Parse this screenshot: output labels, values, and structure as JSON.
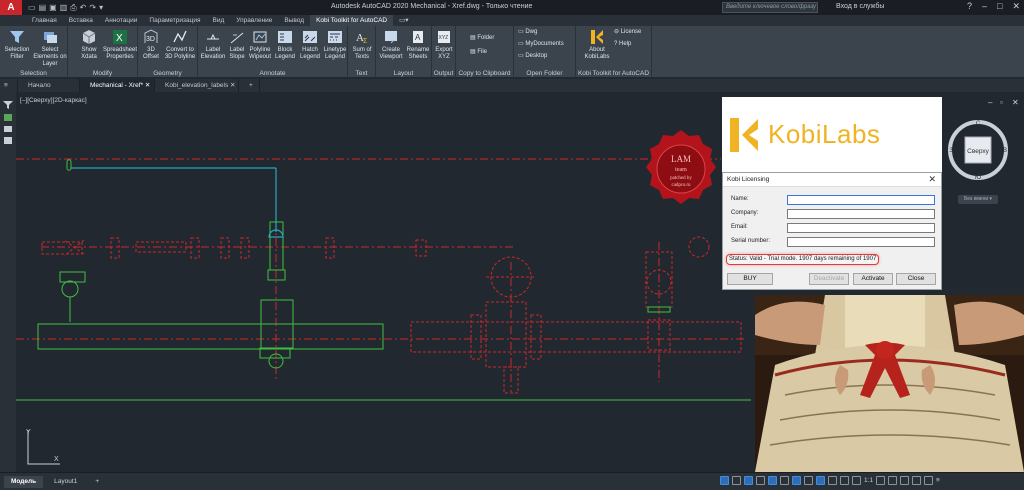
{
  "titlebar": {
    "app_logo": "A",
    "title": "Autodesk AutoCAD 2020   Mechanical - Xref.dwg - Только чтение",
    "search_placeholder": "Введите ключевое слово/фразу",
    "signin": "Вход в службы",
    "qat_icons": [
      "new-icon",
      "open-icon",
      "save-icon",
      "saveas-icon",
      "print-icon",
      "undo-icon",
      "redo-icon",
      "share-icon"
    ]
  },
  "ribbon_tabs": [
    "Главная",
    "Вставка",
    "Аннотации",
    "Параметризация",
    "Вид",
    "Управление",
    "Вывод",
    "Kobi Toolkit for AutoCAD"
  ],
  "active_ribbon_tab": "Kobi Toolkit for AutoCAD",
  "ribbon": {
    "selection": {
      "title": "Selection",
      "buttons": [
        "Selection Filter",
        "Select Elements on Layer"
      ]
    },
    "modify": {
      "title": "Modify",
      "buttons": [
        "Show Xdata",
        "Spreadsheet Properties"
      ]
    },
    "geometry": {
      "title": "Geometry",
      "buttons": [
        "3D Offset",
        "Convert to 3D Polyline"
      ]
    },
    "annotate": {
      "title": "Annotate",
      "buttons": [
        "Label Elevation",
        "Label Slope",
        "Polyline Wipeout",
        "Block Legend",
        "Hatch Legend",
        "Linetype Legend"
      ]
    },
    "text": {
      "title": "Text",
      "buttons": [
        "Sum of Texts"
      ]
    },
    "layout": {
      "title": "Layout",
      "buttons": [
        "Create Viewport",
        "Rename Sheets"
      ]
    },
    "output": {
      "title": "Output",
      "buttons": [
        "Export XYZ"
      ]
    },
    "clipboard": {
      "title": "Copy to Clipboard",
      "buttons": [
        "Folder",
        "File"
      ]
    },
    "openfolder": {
      "title": "Open Folder",
      "buttons": [
        "Dwg",
        "MyDocuments",
        "Desktop"
      ]
    },
    "kobi": {
      "title": "Kobi Toolkit for AutoCAD",
      "buttons": [
        "About KobiLabs",
        "License",
        "Help"
      ]
    }
  },
  "doc_tabs": [
    "Начало",
    "Mechanical - Xref*",
    "Kobi_elevation_labels"
  ],
  "view_label": "[–][Сверху][2D-каркас]",
  "viewcube": {
    "face": "Сверху",
    "compass": [
      "С",
      "В",
      "Ю",
      "З"
    ],
    "wcs": "Без имени"
  },
  "kobi_logo_text": "KobiLabs",
  "dialog": {
    "title": "Kobi Licensing",
    "fields": [
      {
        "label": "Name:",
        "value": ""
      },
      {
        "label": "Company:",
        "value": ""
      },
      {
        "label": "Email:",
        "value": ""
      },
      {
        "label": "Serial number:",
        "value": ""
      }
    ],
    "status": "Status: Valid - Trial mode. 1907 days remaining of 1907",
    "buttons": {
      "buy": "BUY",
      "deactivate": "Deactivate",
      "activate": "Activate",
      "close": "Close"
    }
  },
  "seal_text": [
    "LAM",
    "team",
    "patched by",
    "cadpro.ru"
  ],
  "ucs": {
    "x": "X",
    "y": "Y"
  },
  "statusbar": {
    "tabs": [
      "Модель",
      "Layout1"
    ],
    "scale": "1:1"
  }
}
